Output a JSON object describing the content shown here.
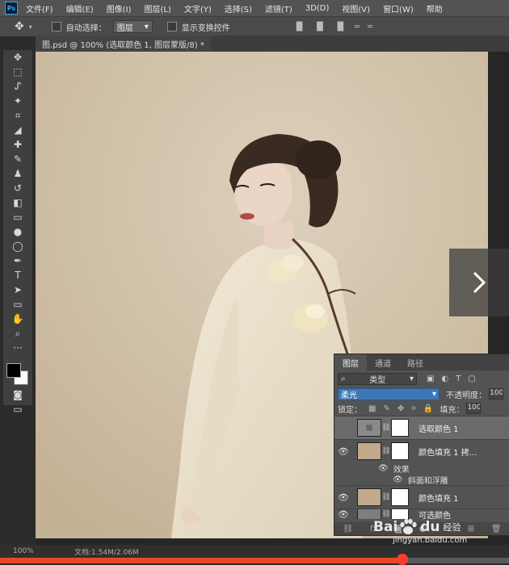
{
  "menubar": {
    "logo": "Ps",
    "items": [
      "文件(F)",
      "编辑(E)",
      "图像(I)",
      "图层(L)",
      "文字(Y)",
      "选择(S)",
      "滤镜(T)",
      "3D(D)",
      "视图(V)",
      "窗口(W)",
      "帮助"
    ]
  },
  "options": {
    "auto_select_label": "自动选择：",
    "auto_select_target": "图层",
    "show_transform_label": "显示变换控件"
  },
  "document_tab": {
    "title": "图.psd @ 100% (选取颜色 1, 图层蒙版/8) *"
  },
  "tools": [
    "move-icon",
    "marquee-icon",
    "lasso-icon",
    "magic-wand-icon",
    "crop-icon",
    "eyedropper-icon",
    "healing-brush-icon",
    "brush-icon",
    "clone-stamp-icon",
    "history-brush-icon",
    "eraser-icon",
    "gradient-icon",
    "blur-icon",
    "dodge-icon",
    "pen-icon",
    "type-icon",
    "path-select-icon",
    "rectangle-icon",
    "hand-icon",
    "zoom-icon",
    "more-icon"
  ],
  "tool_glyphs": [
    "✥",
    "⬚",
    "ᔑ",
    "✦",
    "⌗",
    "◢",
    "✚",
    "✎",
    "♟",
    "↺",
    "◧",
    "▭",
    "●",
    "◯",
    "✒",
    "T",
    "➤",
    "▭",
    "✋",
    "⌕",
    "···"
  ],
  "tool_colors": {
    "foreground": "#000000",
    "background": "#ffffff"
  },
  "layers_panel": {
    "tabs": [
      "图层",
      "通道",
      "路径"
    ],
    "filter_label": "类型",
    "blend_mode": "柔光",
    "opacity_label": "不透明度：",
    "opacity_value": "100",
    "lock_label": "锁定：",
    "fill_label": "填充：",
    "fill_value": "100",
    "layers": [
      {
        "name": "选取颜色 1",
        "thumb": "adjustment",
        "active": true
      },
      {
        "name": "颜色填充 1 拷...",
        "thumb": "fill",
        "effects_label": "效果",
        "effect_items": [
          "斜面和浮雕"
        ]
      },
      {
        "name": "颜色填充 1",
        "thumb": "fill"
      },
      {
        "name": "可选颜色",
        "thumb": "dark"
      }
    ]
  },
  "status": {
    "zoom": "100%",
    "doc": "文档:1.54M/2.06M"
  },
  "video_progress": 0.79,
  "watermark": {
    "brand_text": "Bai",
    "brand_text2": "du",
    "sub": "经验",
    "domain": "jingyan.baidu.com"
  },
  "accent_colors": {
    "progress": "#e64b24",
    "selection": "#3c78b5"
  }
}
